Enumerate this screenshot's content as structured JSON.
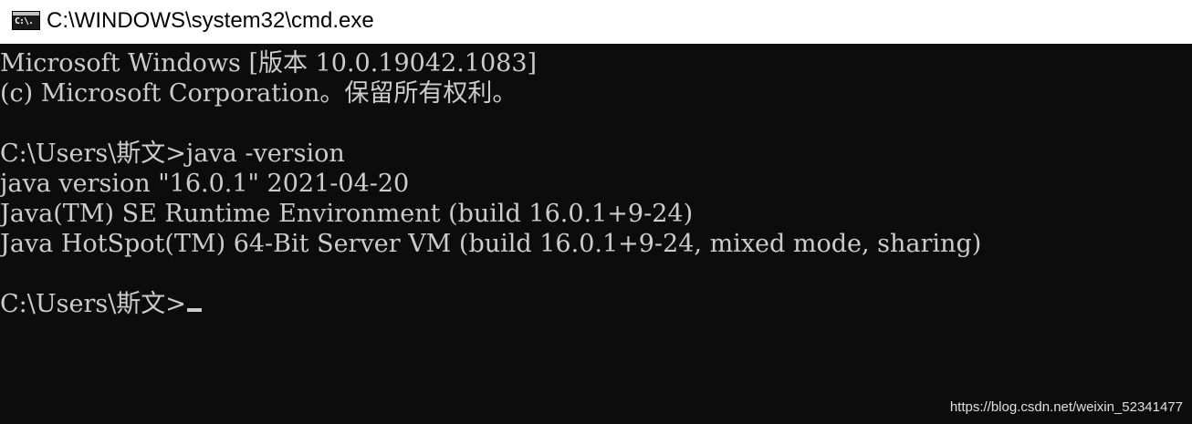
{
  "window": {
    "title": "C:\\WINDOWS\\system32\\cmd.exe",
    "icon_name": "cmd-icon",
    "icon_label": "C:\\."
  },
  "console": {
    "lines": [
      "Microsoft Windows [版本 10.0.19042.1083]",
      "(c) Microsoft Corporation。保留所有权利。",
      "",
      "C:\\Users\\斯文>java -version",
      "java version \"16.0.1\" 2021-04-20",
      "Java(TM) SE Runtime Environment (build 16.0.1+9-24)",
      "Java HotSpot(TM) 64-Bit Server VM (build 16.0.1+9-24, mixed mode, sharing)",
      "",
      "C:\\Users\\斯文>"
    ],
    "text_color": "#cccccc",
    "background_color": "#0c0c0c"
  },
  "watermark": {
    "text": "https://blog.csdn.net/weixin_52341477"
  }
}
